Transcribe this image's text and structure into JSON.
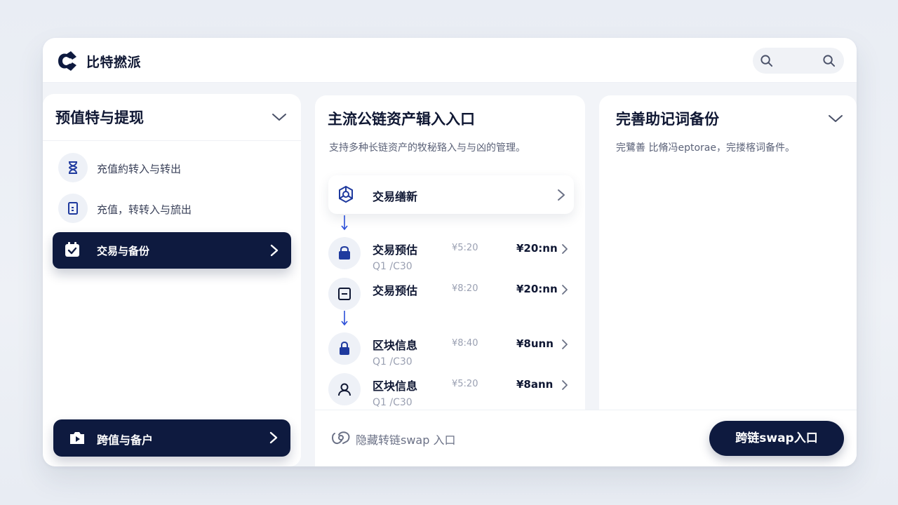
{
  "app": {
    "title": "比特撚派"
  },
  "colors": {
    "primary": "#0e1a3f",
    "accent": "#2b4fd8",
    "background": "#eef1f6"
  },
  "left_panel": {
    "title": "预值特与提现",
    "items": [
      {
        "label": "充值約转入与转出",
        "icon": "hourglass-icon"
      },
      {
        "label": "充值，转转入与旈出",
        "icon": "door-icon"
      },
      {
        "label": "交易与备份",
        "icon": "calendar-check-icon",
        "active": true
      }
    ],
    "bottom_button": {
      "label": "跨值与备户",
      "icon": "camera-icon"
    }
  },
  "mid_panel": {
    "title": "主流公链资产辑入入口",
    "subtitle": "支持多种长链资产的牧秘臵入与与凶的管理。",
    "trade_card": {
      "label": "交易缮新",
      "icon": "network-icon"
    },
    "rows": [
      {
        "name": "交易预估",
        "sub": "Q1 /C30",
        "v1": "¥5:20",
        "v2": "¥20:nn",
        "icon": "bag-icon"
      },
      {
        "name": "交易预估",
        "sub": "",
        "v1": "¥8:20",
        "v2": "¥20:nn",
        "icon": "minus-box-icon"
      },
      {
        "name": "区块信息",
        "sub": "Q1 /C30",
        "v1": "¥8:40",
        "v2": "¥8unn",
        "icon": "lock-icon"
      },
      {
        "name": "区块信息",
        "sub": "Q1 /C30",
        "v1": "¥5:20",
        "v2": "¥8ann",
        "icon": "user-icon"
      }
    ]
  },
  "right_panel": {
    "title": "完善助记词备份",
    "subtitle": "完鷺善 比脩冯eptorae，完搂楁词备件。"
  },
  "footer": {
    "hide_link": "隐藏转链swap 入口",
    "cta": "跨链swap入口"
  }
}
